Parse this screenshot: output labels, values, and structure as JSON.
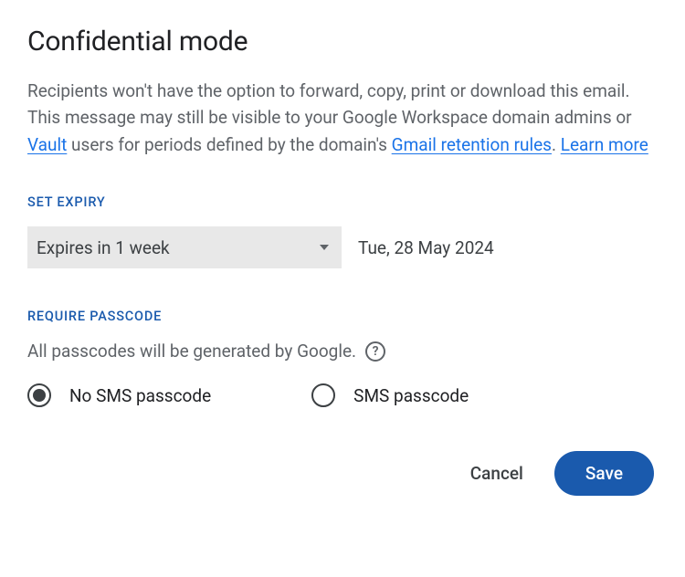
{
  "title": "Confidential mode",
  "description": {
    "text1": "Recipients won't have the option to forward, copy, print or download this email. This message may still be visible to your Google Workspace domain admins or ",
    "link1": "Vault",
    "text2": " users for periods defined by the domain's ",
    "link2": "Gmail retention rules",
    "text3": ". ",
    "link3": "Learn more"
  },
  "expiry": {
    "section_label": "SET EXPIRY",
    "selected": "Expires in 1 week",
    "date": "Tue, 28 May 2024"
  },
  "passcode": {
    "section_label": "REQUIRE PASSCODE",
    "subtext": "All passcodes will be generated by Google.",
    "help_symbol": "?",
    "options": {
      "no_sms": "No SMS passcode",
      "sms": "SMS passcode"
    },
    "selected": "no_sms"
  },
  "buttons": {
    "cancel": "Cancel",
    "save": "Save"
  }
}
